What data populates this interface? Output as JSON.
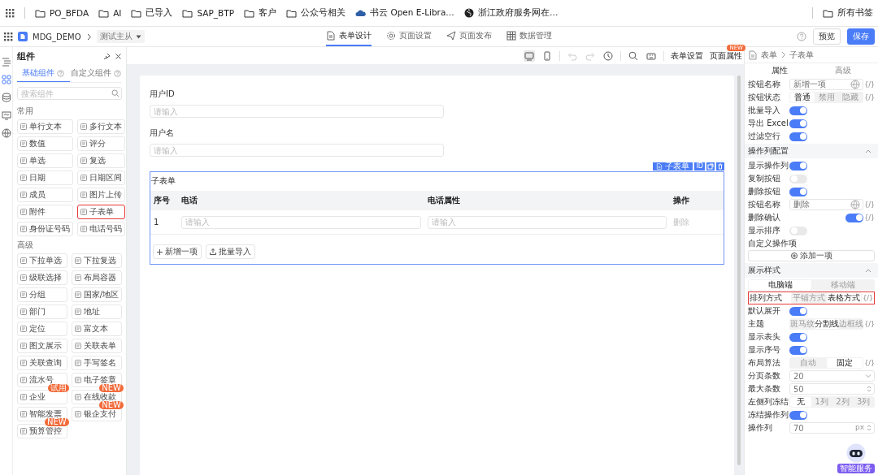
{
  "bookmarks": {
    "items": [
      {
        "label": "PO_BFDA",
        "kind": "folder"
      },
      {
        "label": "AI",
        "kind": "folder"
      },
      {
        "label": "已导入",
        "kind": "folder"
      },
      {
        "label": "SAP_BTP",
        "kind": "folder"
      },
      {
        "label": "客户",
        "kind": "folder"
      },
      {
        "label": "公众号相关",
        "kind": "folder"
      },
      {
        "label": "书云 Open E-Libra…",
        "kind": "cloud"
      },
      {
        "label": "浙江政府服务网在…",
        "kind": "globe"
      }
    ],
    "all_bookmarks": "所有书签"
  },
  "header": {
    "app_name": "MDG_DEMO",
    "page": "测试主从",
    "tabs": [
      {
        "label": "表单设计",
        "selected": true,
        "kind": "design"
      },
      {
        "label": "页面设置",
        "selected": false,
        "kind": "settings"
      },
      {
        "label": "页面发布",
        "selected": false,
        "kind": "publish"
      },
      {
        "label": "数据管理",
        "selected": false,
        "kind": "data"
      }
    ],
    "buttons": [
      {
        "label": "预览",
        "kind": "secondary"
      },
      {
        "label": "保存",
        "kind": "primary"
      }
    ]
  },
  "rail": {
    "items": [
      {
        "kind": "outline",
        "selected": false
      },
      {
        "kind": "components",
        "selected": true
      },
      {
        "kind": "data",
        "selected": false
      },
      {
        "kind": "screen",
        "selected": false
      },
      {
        "kind": "globe",
        "selected": false
      }
    ]
  },
  "components_panel": {
    "title": "组件",
    "tabs": [
      {
        "label": "基础组件",
        "selected": true
      },
      {
        "label": "自定义组件",
        "selected": false
      }
    ],
    "search": {
      "placeholder": "搜索组件"
    },
    "groups": [
      {
        "title": "常用",
        "items": [
          {
            "label": "单行文本"
          },
          {
            "label": "多行文本"
          },
          {
            "label": "数值"
          },
          {
            "label": "评分"
          },
          {
            "label": "单选"
          },
          {
            "label": "复选"
          },
          {
            "label": "日期"
          },
          {
            "label": "日期区间"
          },
          {
            "label": "成员"
          },
          {
            "label": "图片上传"
          },
          {
            "label": "附件"
          },
          {
            "label": "子表单",
            "highlighted": true
          },
          {
            "label": "身份证号码"
          },
          {
            "label": "电话号码"
          }
        ]
      },
      {
        "title": "高级",
        "items": [
          {
            "label": "下拉单选"
          },
          {
            "label": "下拉复选"
          },
          {
            "label": "级联选择"
          },
          {
            "label": "布局容器"
          },
          {
            "label": "分组"
          },
          {
            "label": "国家/地区"
          },
          {
            "label": "部门"
          },
          {
            "label": "地址"
          },
          {
            "label": "定位"
          },
          {
            "label": "富文本"
          },
          {
            "label": "图文展示"
          },
          {
            "label": "关联表单"
          },
          {
            "label": "关联查询"
          },
          {
            "label": "手写签名"
          },
          {
            "label": "流水号"
          },
          {
            "label": "电子签章"
          },
          {
            "label": "企业",
            "badge": "试用"
          },
          {
            "label": "在线收款",
            "badge": "NEW"
          },
          {
            "label": "智能发票"
          },
          {
            "label": "银企支付",
            "badge": "NEW"
          },
          {
            "label": "预算管控",
            "badge": "NEW"
          }
        ]
      }
    ]
  },
  "canvas": {
    "toolbar": {
      "tools": [
        {
          "kind": "desktop",
          "selected": true,
          "disabled": false
        },
        {
          "kind": "mobile",
          "selected": false,
          "disabled": false
        },
        {
          "kind": "undo",
          "selected": false,
          "disabled": true
        },
        {
          "kind": "redo",
          "selected": false,
          "disabled": true
        },
        {
          "kind": "history",
          "selected": false,
          "disabled": false
        },
        {
          "kind": "search",
          "selected": false,
          "disabled": false
        },
        {
          "kind": "keyboard",
          "selected": false,
          "disabled": false
        }
      ],
      "links": [
        {
          "label": "表单设置"
        },
        {
          "label": "页面属性",
          "badge": "NEW"
        }
      ]
    },
    "form": {
      "fields": [
        {
          "label": "用户ID",
          "placeholder": "请输入"
        },
        {
          "label": "用户名",
          "placeholder": "请输入"
        }
      ],
      "subform": {
        "selected": true,
        "tag": "子表单",
        "id_label": "ID",
        "title": "子表单",
        "columns": [
          "序号",
          "电话",
          "电话属性",
          "操作"
        ],
        "rows": [
          {
            "cells": [
              {
                "kind": "text",
                "text": "1"
              },
              {
                "kind": "input",
                "placeholder": "请输入"
              },
              {
                "kind": "input",
                "placeholder": "请输入"
              },
              {
                "kind": "link",
                "text": "删除"
              }
            ]
          }
        ],
        "buttons": [
          {
            "label": "新增一项",
            "kind": "add"
          },
          {
            "label": "批量导入",
            "kind": "import"
          }
        ]
      }
    }
  },
  "props_panel": {
    "breadcrumb": [
      "表单",
      "子表单"
    ],
    "tabs": [
      {
        "label": "属性",
        "selected": true
      },
      {
        "label": "高级",
        "selected": false
      }
    ],
    "rows": [
      {
        "kind": "input",
        "label": "按钮名称",
        "value": "新增一项",
        "expr": "{/}"
      },
      {
        "kind": "segmented",
        "label": "按钮状态",
        "options": [
          {
            "label": "普通",
            "selected": true
          },
          {
            "label": "禁用",
            "selected": false
          },
          {
            "label": "隐藏",
            "selected": false
          }
        ],
        "expr": "{/}"
      },
      {
        "kind": "toggle",
        "label": "批量导入",
        "on": true
      },
      {
        "kind": "toggle",
        "label": "导出 Excel",
        "on": true
      },
      {
        "kind": "toggle",
        "label": "过滤空行",
        "on": true
      },
      {
        "kind": "section",
        "label": "操作列配置",
        "expanded": true
      },
      {
        "kind": "toggle",
        "label": "显示操作列",
        "on": true
      },
      {
        "kind": "toggle",
        "label": "复制按钮",
        "on": false
      },
      {
        "kind": "toggle",
        "label": "删除按钮",
        "on": true
      },
      {
        "kind": "input",
        "label": "按钮名称",
        "value": "删除",
        "expr": "{/}"
      },
      {
        "kind": "toggle_end",
        "label": "删除确认",
        "on": true,
        "expr": "{/}"
      },
      {
        "kind": "toggle",
        "label": "显示排序",
        "on": false
      },
      {
        "kind": "heading",
        "label": "自定义操作项"
      },
      {
        "kind": "button",
        "label": "添加一项"
      },
      {
        "kind": "section",
        "label": "展示样式",
        "expanded": true
      },
      {
        "kind": "tabs",
        "options": [
          {
            "label": "电脑端",
            "selected": true
          },
          {
            "label": "移动端",
            "selected": false
          }
        ]
      },
      {
        "kind": "segmented",
        "label": "排列方式",
        "options": [
          {
            "label": "平铺方式",
            "selected": false
          },
          {
            "label": "表格方式",
            "selected": true
          }
        ],
        "expr": "{/}",
        "highlighted": true
      },
      {
        "kind": "toggle",
        "label": "默认展开",
        "on": true
      },
      {
        "kind": "segmented",
        "label": "主题",
        "options": [
          {
            "label": "斑马纹",
            "selected": false
          },
          {
            "label": "分割线",
            "selected": true
          },
          {
            "label": "边框线",
            "selected": false
          }
        ],
        "expr": "{/}"
      },
      {
        "kind": "toggle",
        "label": "显示表头",
        "on": true
      },
      {
        "kind": "toggle",
        "label": "显示序号",
        "on": true
      },
      {
        "kind": "segmented",
        "label": "布局算法",
        "options": [
          {
            "label": "自动",
            "selected": false
          },
          {
            "label": "固定",
            "selected": true
          }
        ],
        "expr": "{/}"
      },
      {
        "kind": "select",
        "label": "分页条数",
        "value": "20"
      },
      {
        "kind": "number",
        "label": "最大条数",
        "value": "50"
      },
      {
        "kind": "segmented",
        "label": "左侧列冻结",
        "options": [
          {
            "label": "无",
            "selected": true
          },
          {
            "label": "1列",
            "selected": false
          },
          {
            "label": "2列",
            "selected": false
          },
          {
            "label": "3列",
            "selected": false
          }
        ]
      },
      {
        "kind": "toggle",
        "label": "冻结操作列",
        "on": true
      },
      {
        "kind": "number",
        "label": "操作列",
        "value": "70",
        "unit": "px"
      }
    ]
  },
  "assistant": {
    "label": "智能服务"
  }
}
